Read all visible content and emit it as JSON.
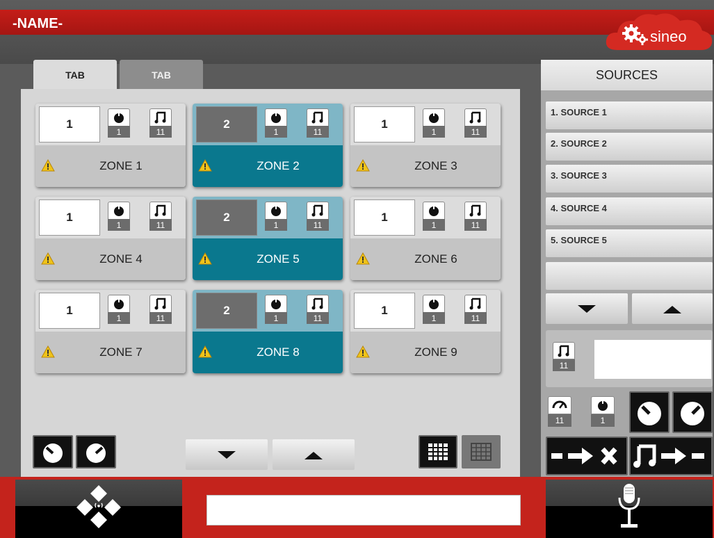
{
  "app": {
    "title": "-NAME-",
    "logo_text": "sineo"
  },
  "tabs": [
    {
      "label": "TAB",
      "active": true
    },
    {
      "label": "TAB",
      "active": false
    }
  ],
  "zones": [
    {
      "name": "ZONE 1",
      "number": "1",
      "volume_badge": "1",
      "music_badge": "11",
      "active": false
    },
    {
      "name": "ZONE 2",
      "number": "2",
      "volume_badge": "1",
      "music_badge": "11",
      "active": true
    },
    {
      "name": "ZONE 3",
      "number": "1",
      "volume_badge": "1",
      "music_badge": "11",
      "active": false
    },
    {
      "name": "ZONE 4",
      "number": "1",
      "volume_badge": "1",
      "music_badge": "11",
      "active": false
    },
    {
      "name": "ZONE 5",
      "number": "2",
      "volume_badge": "1",
      "music_badge": "11",
      "active": true
    },
    {
      "name": "ZONE 6",
      "number": "1",
      "volume_badge": "1",
      "music_badge": "11",
      "active": false
    },
    {
      "name": "ZONE 7",
      "number": "1",
      "volume_badge": "1",
      "music_badge": "11",
      "active": false
    },
    {
      "name": "ZONE 8",
      "number": "2",
      "volume_badge": "1",
      "music_badge": "11",
      "active": true
    },
    {
      "name": "ZONE 9",
      "number": "1",
      "volume_badge": "1",
      "music_badge": "11",
      "active": false
    }
  ],
  "sources": {
    "header": "SOURCES",
    "items": [
      "1. SOURCE 1",
      "2. SOURCE 2",
      "3. SOURCE 3",
      "4. SOURCE 4",
      "5. SOURCE 5",
      ""
    ],
    "selected_music_badge": "11",
    "selected_value": ""
  },
  "right_controls": {
    "level_badge": "11",
    "volume_badge": "1"
  },
  "footer": {
    "input_value": ""
  },
  "icons": [
    "volume-down-icon",
    "volume-up-icon",
    "arrow-down-icon",
    "arrow-up-icon",
    "grid-large-icon",
    "grid-small-icon",
    "warning-icon",
    "music-note-icon",
    "knob-icon",
    "gauge-icon",
    "unassign-icon",
    "assign-icon",
    "dpad-icon",
    "microphone-icon",
    "gear-icon"
  ],
  "colors": {
    "brand_red": "#c41d18",
    "zone_active": "#0a788e",
    "zone_active_top": "#7fb6c6",
    "warning": "#f0c419"
  }
}
